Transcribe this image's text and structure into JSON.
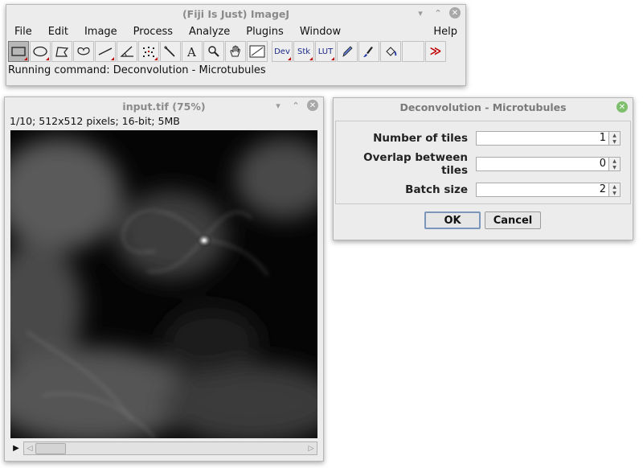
{
  "imagej": {
    "title": "(Fiji Is Just) ImageJ",
    "menu": [
      "File",
      "Edit",
      "Image",
      "Process",
      "Analyze",
      "Plugins",
      "Window"
    ],
    "help": "Help",
    "tools": [
      {
        "name": "rectangle-tool-icon",
        "selected": true
      },
      {
        "name": "oval-tool-icon"
      },
      {
        "name": "polygon-tool-icon"
      },
      {
        "name": "freehand-tool-icon"
      },
      {
        "name": "line-tool-icon"
      },
      {
        "name": "angle-tool-icon"
      },
      {
        "name": "point-tool-icon"
      },
      {
        "name": "wand-tool-icon"
      },
      {
        "name": "text-tool-icon"
      },
      {
        "name": "magnifier-tool-icon"
      },
      {
        "name": "hand-tool-icon"
      },
      {
        "name": "color-picker-tool-icon"
      }
    ],
    "dev_label": "Dev",
    "stk_label": "Stk",
    "lut_label": "LUT",
    "status": "Running command: Deconvolution - Microtubules"
  },
  "image_window": {
    "title": "input.tif (75%)",
    "info": "1/10; 512x512 pixels; 16-bit; 5MB"
  },
  "dialog": {
    "title": "Deconvolution - Microtubules",
    "fields": [
      {
        "label": "Number of tiles",
        "value": "1"
      },
      {
        "label": "Overlap between tiles",
        "value": "0"
      },
      {
        "label": "Batch size",
        "value": "2"
      }
    ],
    "ok_label": "OK",
    "cancel_label": "Cancel"
  }
}
